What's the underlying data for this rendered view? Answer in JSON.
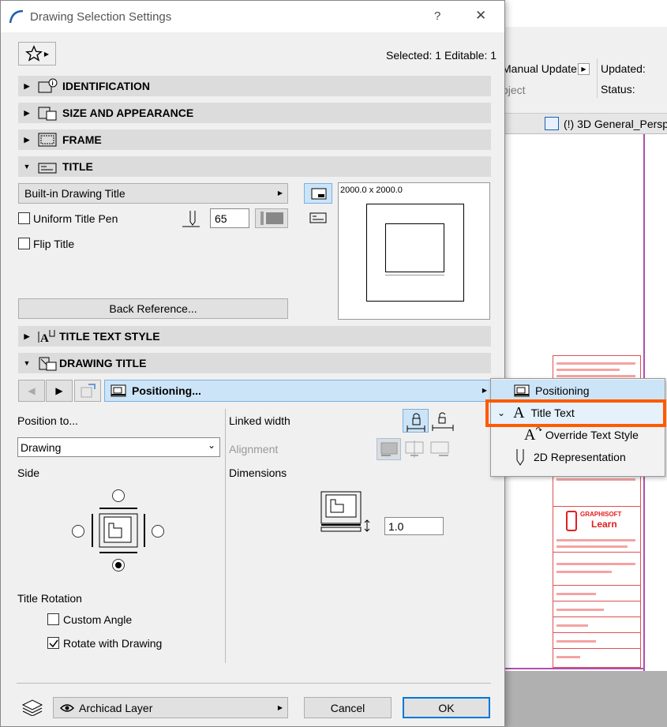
{
  "window": {
    "title": "Drawing Selection Settings",
    "help": "?",
    "close": "✕"
  },
  "status": "Selected: 1 Editable: 1",
  "sections": {
    "identification": "IDENTIFICATION",
    "size": "SIZE AND APPEARANCE",
    "frame": "FRAME",
    "title": "TITLE",
    "title_text_style": "TITLE TEXT STYLE",
    "drawing_title": "DRAWING TITLE"
  },
  "title_panel": {
    "dropdown": "Built-in Drawing Title",
    "uniform_pen": "Uniform Title Pen",
    "pen_value": "65",
    "flip_title": "Flip Title",
    "back_ref": "Back Reference...",
    "preview_size": "2000.0 x 2000.0"
  },
  "nav": {
    "current": "Positioning..."
  },
  "menu": {
    "items": [
      "Positioning",
      "Title Text",
      "Override Text Style",
      "2D Representation"
    ]
  },
  "positioning": {
    "position_to_label": "Position to...",
    "position_to_value": "Drawing",
    "side": "Side",
    "linked_width": "Linked width",
    "alignment": "Alignment",
    "dimensions": "Dimensions",
    "dim_value": "1.0",
    "title_rotation": "Title Rotation",
    "custom_angle": "Custom Angle",
    "rotate_with_drawing": "Rotate with Drawing"
  },
  "footer": {
    "layer": "Archicad Layer",
    "cancel": "Cancel",
    "ok": "OK"
  },
  "background": {
    "manual_update": "Manual Update",
    "updated": "Updated:",
    "project": "oject",
    "status": "Status:",
    "tab": "(!) 3D General_Persp",
    "logo_top": "GRAPHISOFT",
    "logo_bottom": "Learn"
  },
  "colors": {
    "accent": "#0078d7",
    "highlight": "#cce4f7",
    "orange": "#ff5a00",
    "red": "#e05050"
  }
}
